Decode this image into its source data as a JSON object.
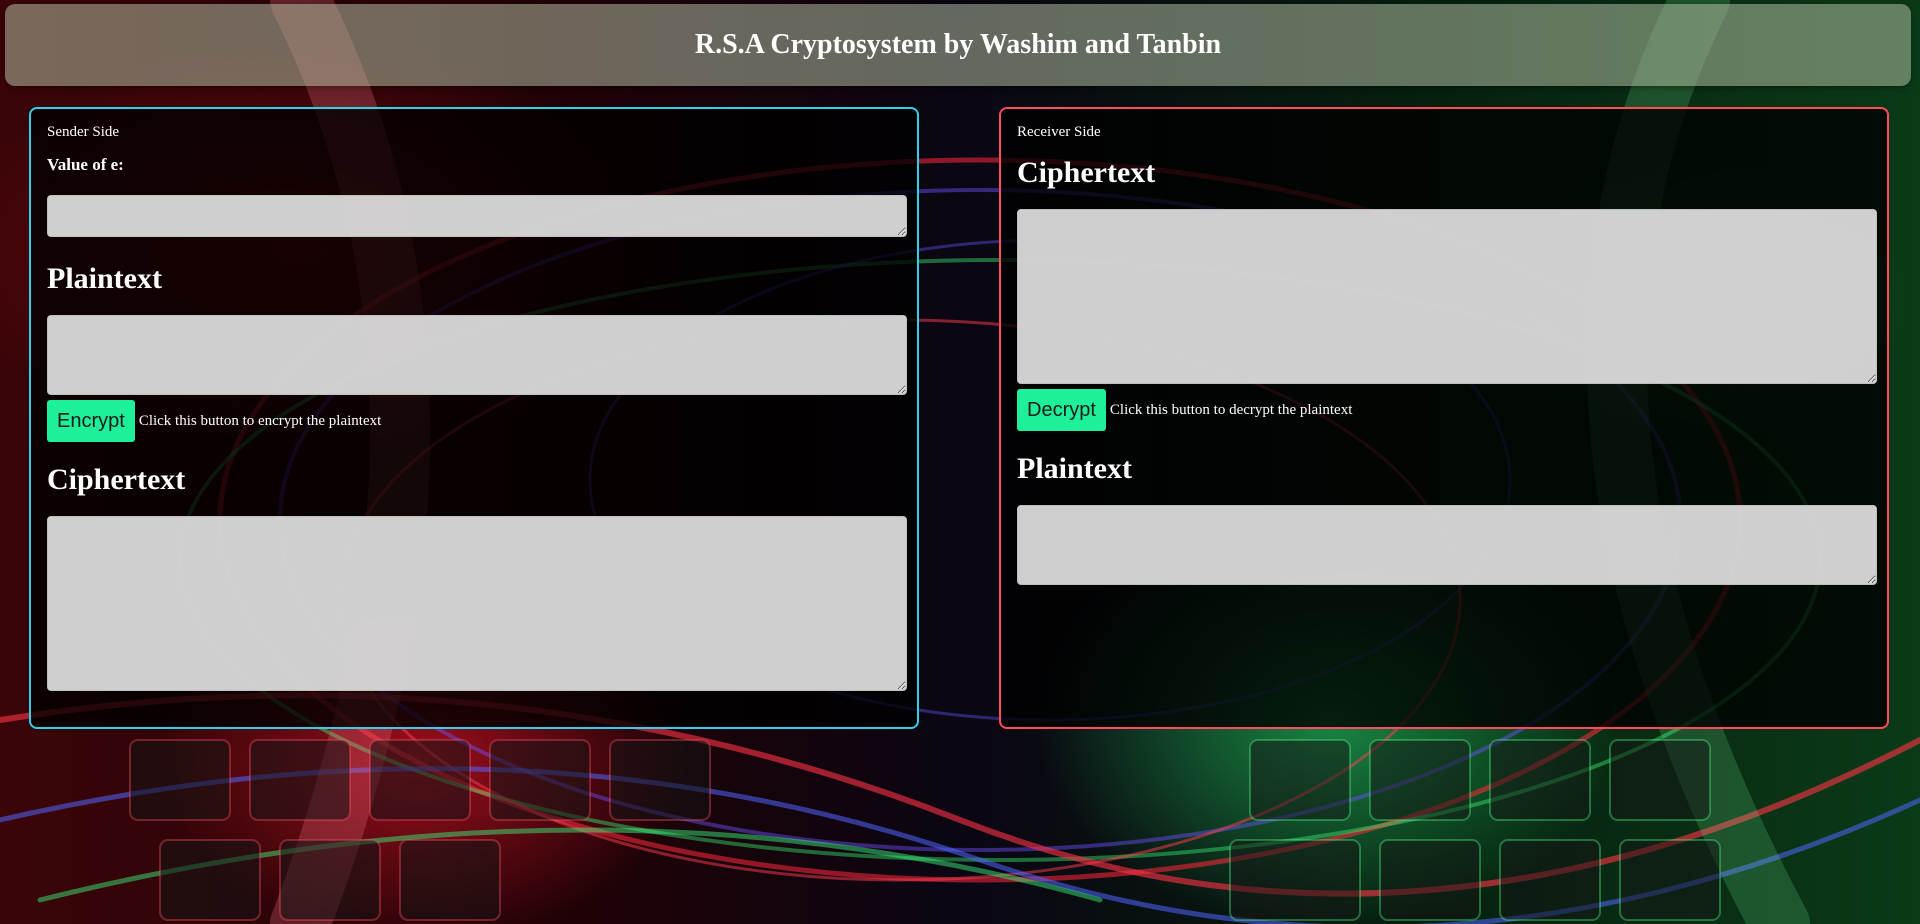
{
  "header": {
    "title": "R.S.A Cryptosystem by Washim and Tanbin"
  },
  "sender": {
    "panel_label": "Sender Side",
    "e_label": "Value of e:",
    "e_value": "",
    "plaintext_title": "Plaintext",
    "plaintext_value": "",
    "encrypt_button": "Encrypt",
    "encrypt_hint": "Click this button to encrypt the plaintext",
    "ciphertext_title": "Ciphertext",
    "ciphertext_value": ""
  },
  "receiver": {
    "panel_label": "Receiver Side",
    "ciphertext_title": "Ciphertext",
    "ciphertext_value": "",
    "decrypt_button": "Decrypt",
    "decrypt_hint": "Click this button to decrypt the plaintext",
    "plaintext_title": "Plaintext",
    "plaintext_value": ""
  },
  "colors": {
    "sender_border": "#2fd0e8",
    "receiver_border": "#ff4b5c",
    "button_bg": "#1ef09a",
    "header_bg": "#afb9a0"
  }
}
